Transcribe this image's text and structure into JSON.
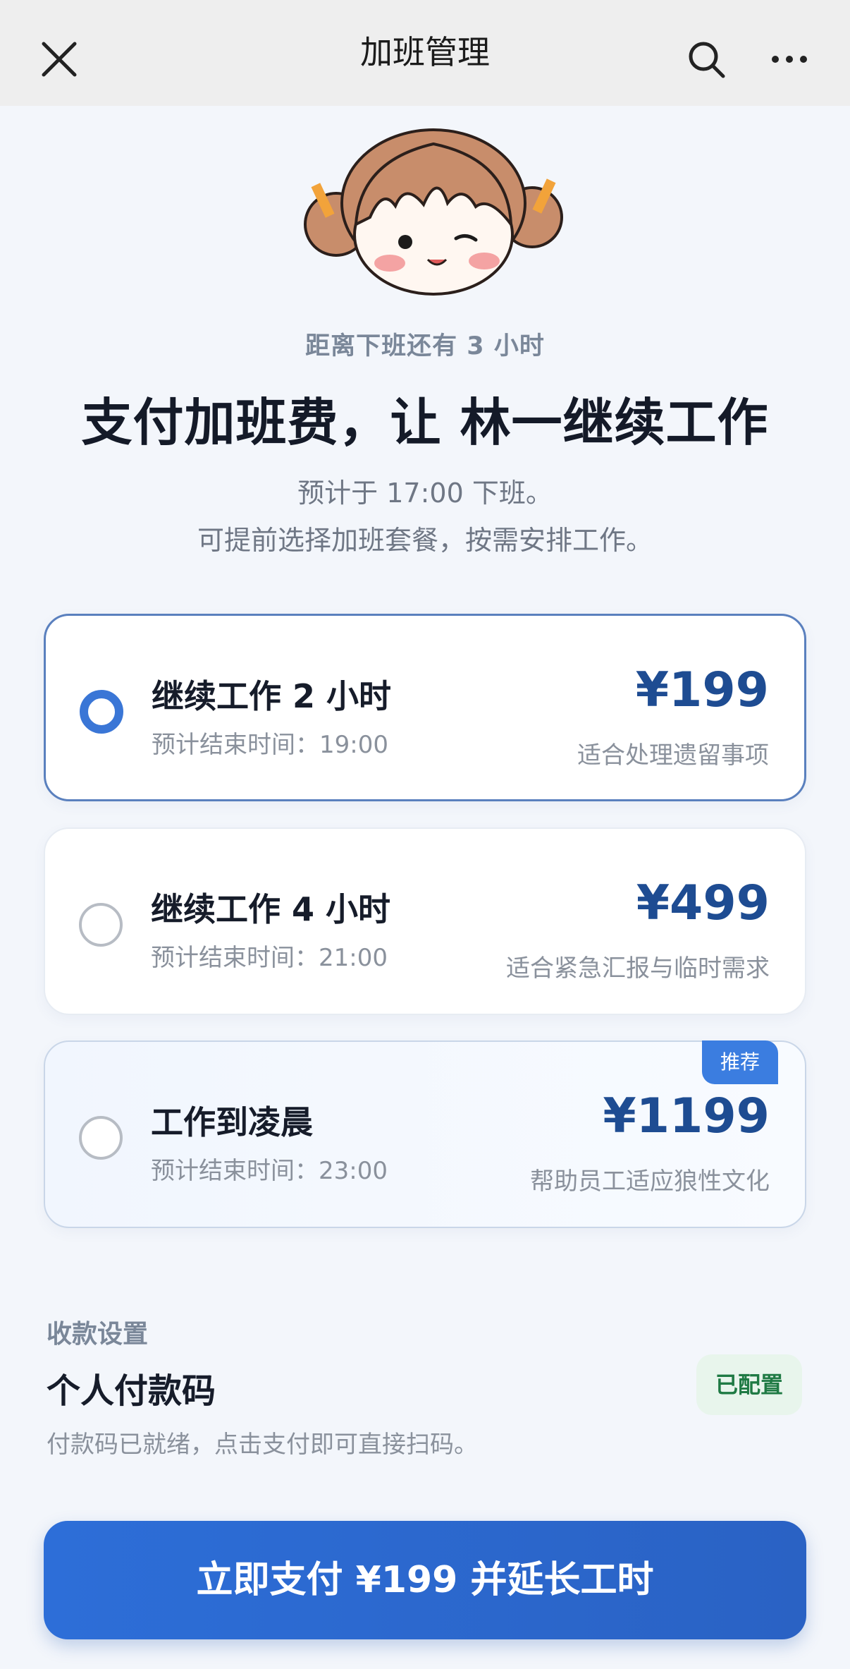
{
  "header": {
    "title": "加班管理"
  },
  "hero": {
    "countdown": "距离下班还有 3 小时",
    "headline": "支付加班费，让 林一继续工作",
    "desc_line1": "预计于 17:00 下班。",
    "desc_line2": "可提前选择加班套餐，按需安排工作。"
  },
  "plans": [
    {
      "name": "继续工作 2 小时",
      "end_time": "预计结束时间：19:00",
      "price": "¥199",
      "note": "适合处理遗留事项",
      "selected": true
    },
    {
      "name": "继续工作 4 小时",
      "end_time": "预计结束时间：21:00",
      "price": "¥499",
      "note": "适合紧急汇报与临时需求",
      "selected": false
    },
    {
      "name": "工作到凌晨",
      "end_time": "预计结束时间：23:00",
      "price": "¥1199",
      "note": "帮助员工适应狼性文化",
      "selected": false,
      "badge": "推荐"
    }
  ],
  "payment": {
    "section_label": "收款设置",
    "method": "个人付款码",
    "status": "已配置",
    "hint": "付款码已就绪，点击支付即可直接扫码。"
  },
  "cta": {
    "label": "立即支付 ¥199 并延长工时"
  },
  "colors": {
    "accent": "#3a76d6",
    "price": "#1e4c92",
    "status_green": "#1f7a44"
  },
  "icons": [
    "close-icon",
    "search-icon",
    "more-icon",
    "radio-selected-icon",
    "radio-unselected-icon"
  ]
}
